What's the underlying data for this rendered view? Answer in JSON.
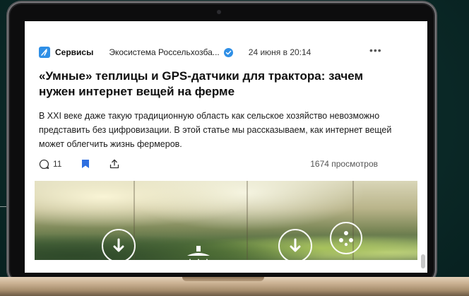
{
  "post": {
    "service_name": "Сервисы",
    "author": "Экосистема Россельхозба...",
    "date": "24 июня в 20:14",
    "more": "•••",
    "title": "«Умные» теплицы и GPS-датчики для трактора: зачем нужен интернет вещей на ферме",
    "lead": "В XXI веке даже такую традиционную область как сельское хозяйство невозможно представить без цифровизации. В этой статье мы рассказываем, как интернет вещей может облегчить жизнь фермеров.",
    "comments_count": "11",
    "views": "1674 просмотров"
  },
  "icons": {
    "service_logo": "service-logo-icon",
    "verified": "verified-badge-icon",
    "comment": "comment-icon",
    "bookmark": "bookmark-icon",
    "share": "share-icon",
    "hero_icons": [
      "download-arrow-icon",
      "irrigation-icon",
      "download-arrow-icon",
      "pests-icon"
    ]
  },
  "colors": {
    "accent": "#2f8fe6",
    "background": "#0b2a28",
    "laptop_base": "#c9b091"
  }
}
